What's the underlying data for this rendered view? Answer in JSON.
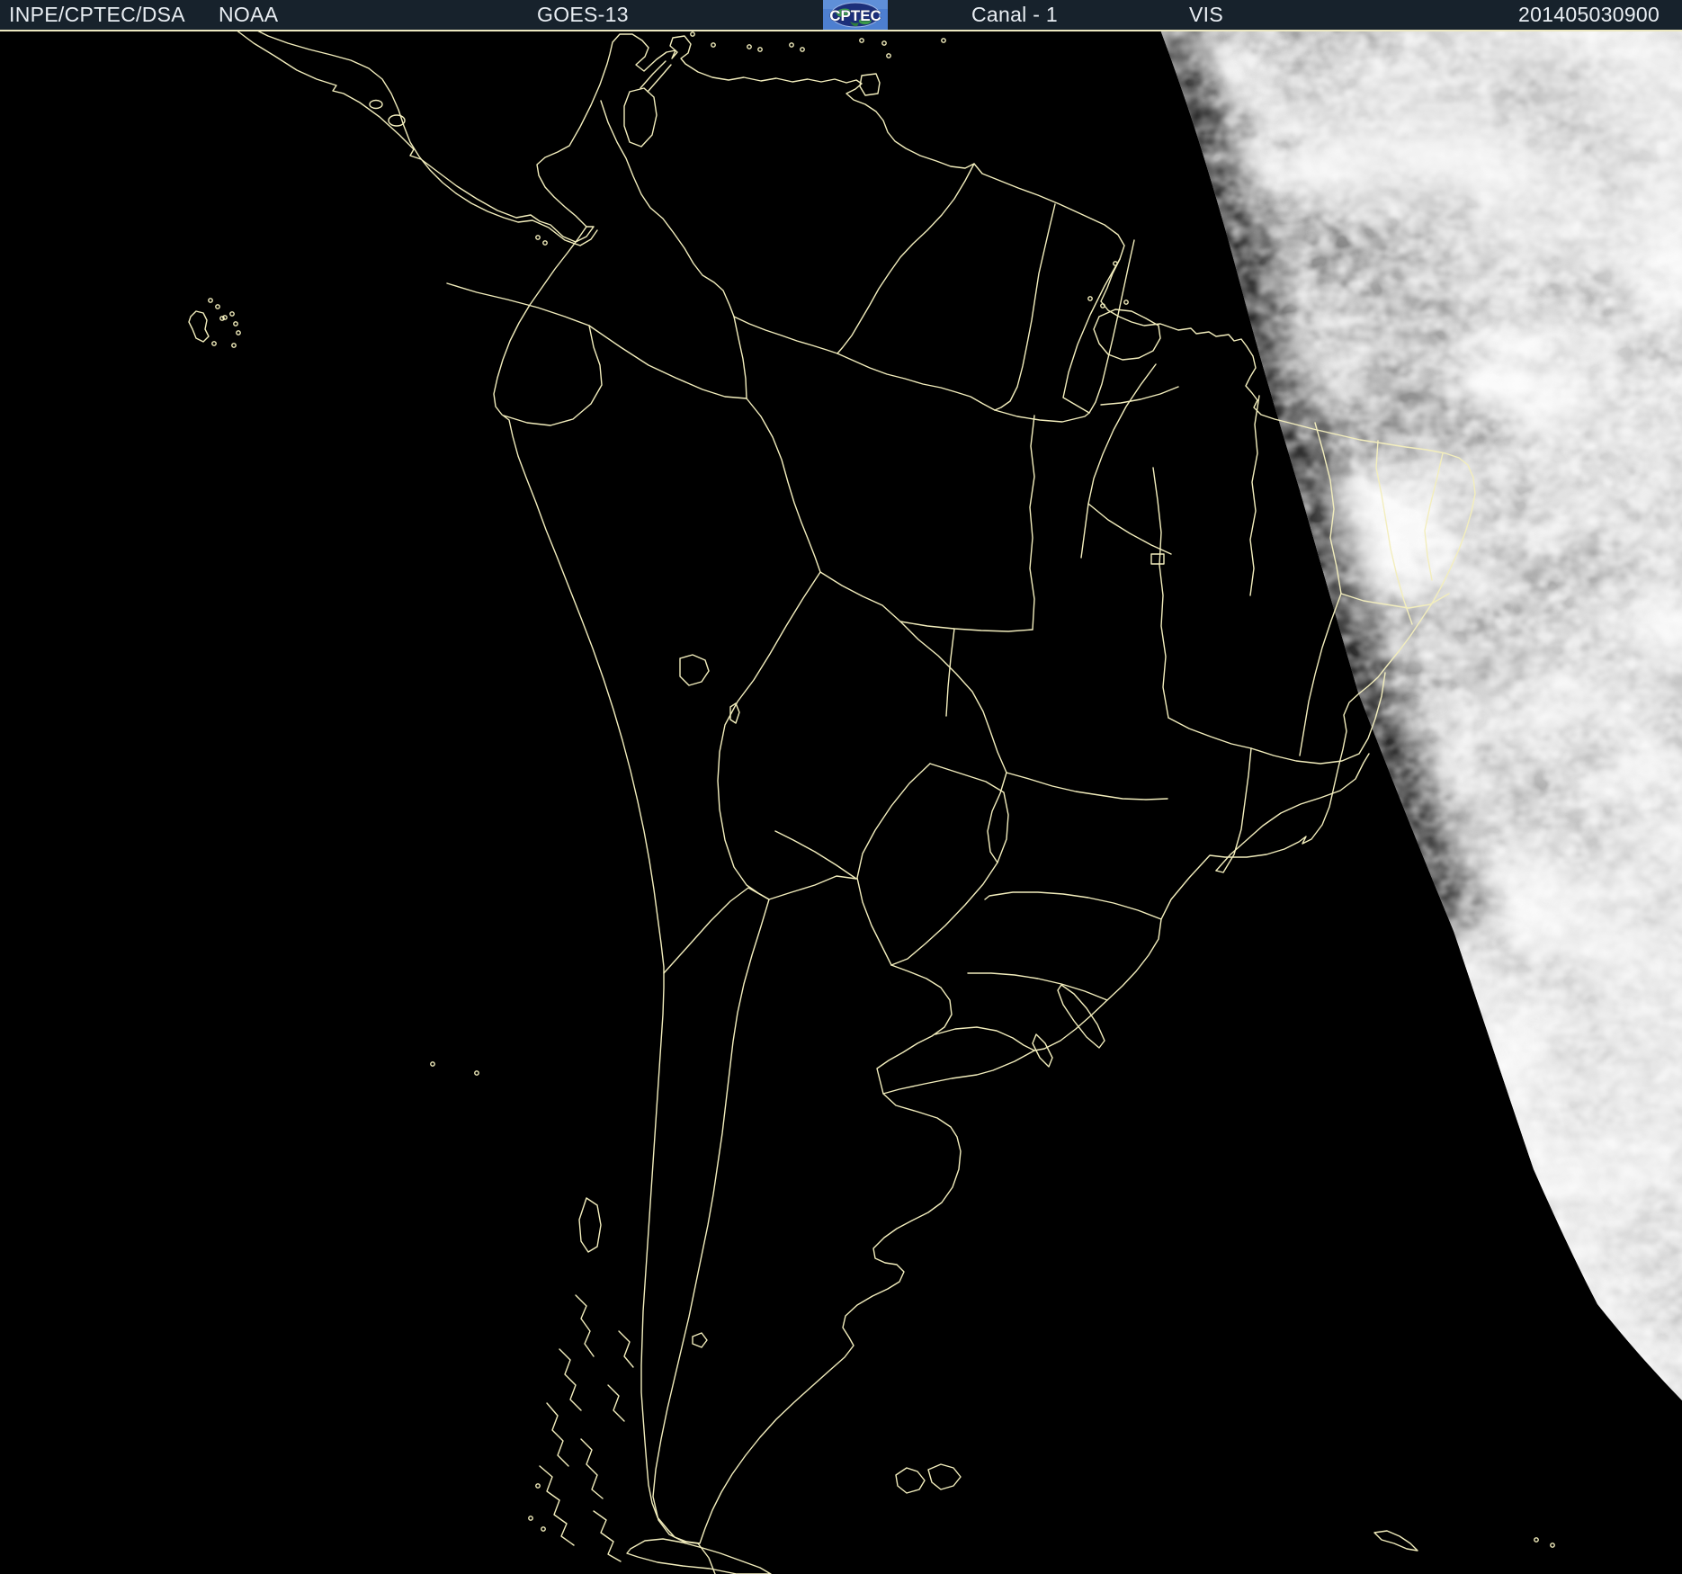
{
  "header": {
    "product": "INPE/CPTEC/DSA",
    "agency": "NOAA",
    "satellite": "GOES-13",
    "channel": "Canal - 1",
    "band": "VIS",
    "timestamp": "201405030900"
  },
  "logo": {
    "text": "CPTEC"
  },
  "map": {
    "region": "South America",
    "overlay": "country and state boundary outlines",
    "daylight": "sunlit cloud field crescent on right side, night side black"
  },
  "colors": {
    "header_bg": "#17222c",
    "header_text": "#e9eef3",
    "outline": "#f3eebd",
    "frame_line": "#ece8c0",
    "night": "#000000",
    "day_base": "#7d7d7d",
    "logo_bg": "#4d7fd0",
    "logo_globe": "#1c2f7a",
    "logo_land": "#3a9a4a"
  }
}
